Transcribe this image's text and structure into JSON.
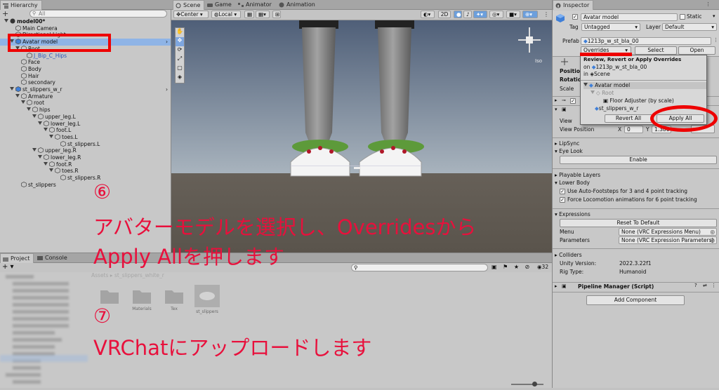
{
  "hierarchy": {
    "tab_label": "Hierarchy",
    "search_placeholder": "All",
    "add_label": "+",
    "items": [
      {
        "label": "model00*",
        "level": 0
      },
      {
        "label": "Main Camera",
        "level": 1
      },
      {
        "label": "Directional Light",
        "level": 1
      },
      {
        "label": "Avatar model",
        "level": 1
      },
      {
        "label": "Root",
        "level": 2
      },
      {
        "label": "J_Bip_C_Hips",
        "level": 3
      },
      {
        "label": "Face",
        "level": 2
      },
      {
        "label": "Body",
        "level": 2
      },
      {
        "label": "Hair",
        "level": 2
      },
      {
        "label": "secondary",
        "level": 2
      },
      {
        "label": "st_slippers_w_r",
        "level": 1
      },
      {
        "label": "Armature",
        "level": 2
      },
      {
        "label": "root",
        "level": 3
      },
      {
        "label": "hips",
        "level": 4
      },
      {
        "label": "upper_leg.L",
        "level": 5
      },
      {
        "label": "lower_leg.L",
        "level": 6
      },
      {
        "label": "foot.L",
        "level": 7
      },
      {
        "label": "toes.L",
        "level": 8
      },
      {
        "label": "st_slippers.L",
        "level": 9
      },
      {
        "label": "upper_leg.R",
        "level": 5
      },
      {
        "label": "lower_leg.R",
        "level": 6
      },
      {
        "label": "foot.R",
        "level": 7
      },
      {
        "label": "toes.R",
        "level": 8
      },
      {
        "label": "st_slippers.R",
        "level": 9
      },
      {
        "label": "st_slippers",
        "level": 2
      }
    ]
  },
  "scene": {
    "tabs": [
      "Scene",
      "Game",
      "Animator",
      "Animation"
    ],
    "pivot": "Center",
    "space": "Local",
    "mode_2d": "2D",
    "persp_label": "Iso"
  },
  "project": {
    "tabs": [
      "Project",
      "Console"
    ],
    "breadcrumb": [
      "Assets",
      "st_slippers_white_r"
    ],
    "count": "32",
    "assets": [
      "",
      "Materials",
      "Tex",
      "st_slippers"
    ]
  },
  "inspector": {
    "tab_label": "Inspector",
    "object_name": "Avatar model",
    "static_label": "Static",
    "tag_label": "Tag",
    "tag_value": "Untagged",
    "layer_label": "Layer",
    "layer_value": "Default",
    "prefab_label": "Prefab",
    "prefab_value": "1213p_w_st_bla_00",
    "overrides_label": "Overrides",
    "select_label": "Select",
    "open_label": "Open",
    "transform_labels": [
      "Position",
      "Rotation",
      "Scale"
    ],
    "view_label": "View",
    "view_position_label": "View Position",
    "view_x_label": "X",
    "view_x_value": "0",
    "view_y_label": "Y",
    "view_y_value": "1.386",
    "lipsync": "LipSync",
    "eye_look": "Eye Look",
    "enable_label": "Enable",
    "playable_layers": "Playable Layers",
    "lower_body": "Lower Body",
    "auto_footsteps": "Use Auto-Footsteps for 3 and 4 point tracking",
    "force_locomotion": "Force Locomotion animations for 6 point tracking",
    "expressions": "Expressions",
    "reset_default": "Reset To Default",
    "menu_label": "Menu",
    "menu_value": "None (VRC Expressions Menu)",
    "parameters_label": "Parameters",
    "parameters_value": "None (VRC Expression Parameters)",
    "colliders": "Colliders",
    "unity_version_label": "Unity Version:",
    "unity_version_value": "2022.3.22f1",
    "rig_type_label": "Rig Type:",
    "rig_type_value": "Humanoid",
    "pipeline_label": "Pipeline Manager (Script)",
    "add_component": "Add Component"
  },
  "overrides_popup": {
    "title": "Review, Revert or Apply Overrides",
    "on_label": "on",
    "on_value": "1213p_w_st_bla_00",
    "in_label": "in",
    "in_value": "Scene",
    "tree": [
      "Avatar model",
      "Root",
      "Floor Adjuster (by scale)",
      "st_slippers_w_r"
    ],
    "revert_all": "Revert All",
    "apply_all": "Apply All"
  },
  "annotation": {
    "step6_num": "⑥",
    "step6_line1": "アバターモデルを選択し、Overridesから",
    "step6_line2": "Apply Allを押します",
    "step7_num": "⑦",
    "step7_line1": "VRChatにアップロードします"
  },
  "colors": {
    "annotation_red": "#e8103c",
    "highlight_red": "#ee0000",
    "selection_blue": "#8fb4e6"
  }
}
